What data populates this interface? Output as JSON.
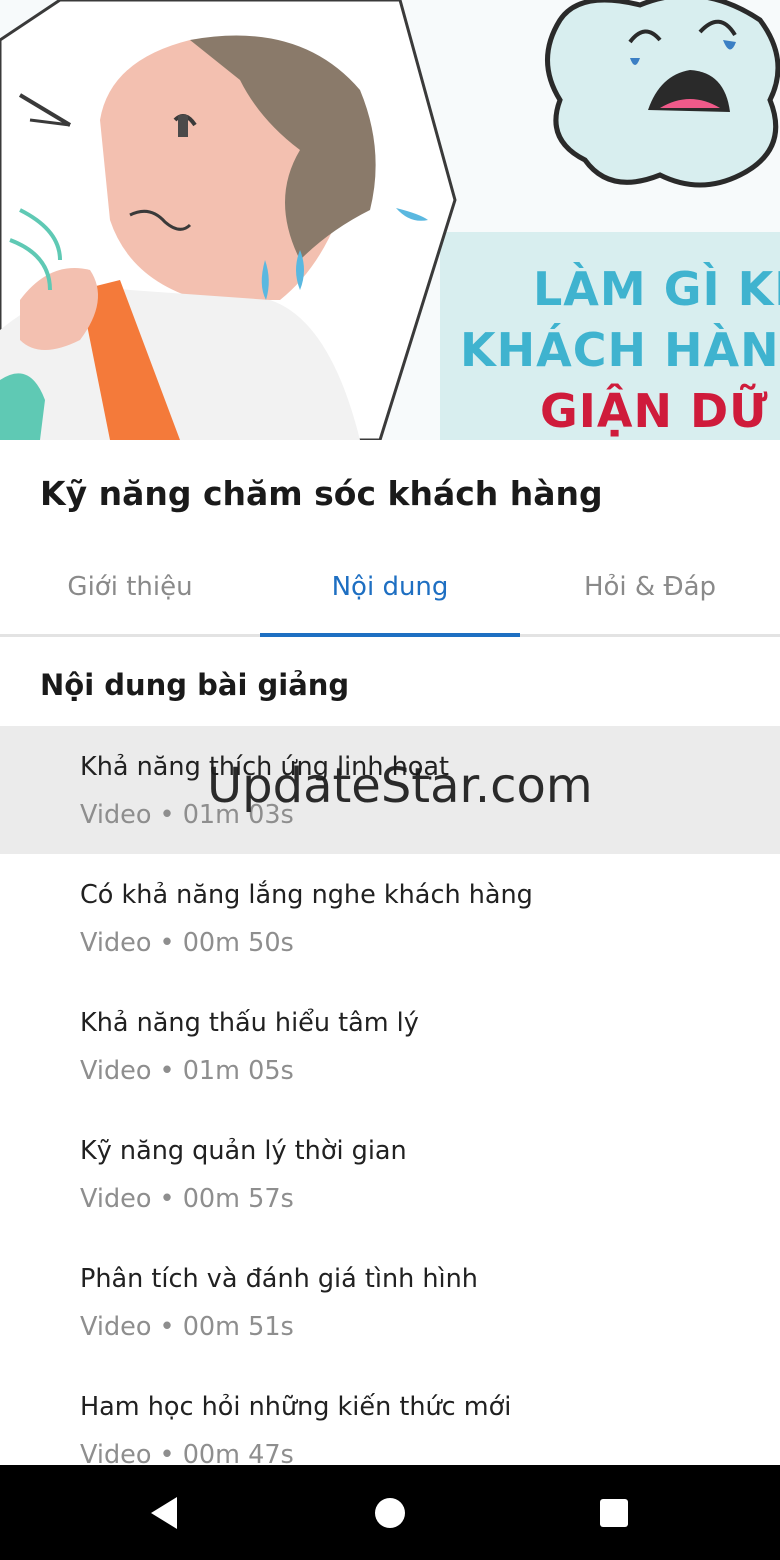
{
  "hero": {
    "image_text_lines": [
      "LÀM GÌ KHI",
      "KHÁCH HÀNG",
      "GIẬN DỮ"
    ],
    "colors": {
      "cyan": "#3fb3cf",
      "red": "#cf1b3b"
    }
  },
  "header": {
    "back_icon": "close-icon"
  },
  "course": {
    "title": "Kỹ năng chăm sóc khách hàng"
  },
  "tabs": [
    {
      "label": "Giới thiệu",
      "active": false
    },
    {
      "label": "Nội dung",
      "active": true
    },
    {
      "label": "Hỏi & Đáp",
      "active": false
    }
  ],
  "content": {
    "section_title": "Nội dung bài giảng",
    "lessons": [
      {
        "title": "Khả năng thích ứng linh hoạt",
        "meta": "Video • 01m 03s",
        "highlighted": true
      },
      {
        "title": "Có khả năng lắng nghe khách hàng",
        "meta": "Video • 00m 50s",
        "highlighted": false
      },
      {
        "title": "Khả năng thấu hiểu tâm lý",
        "meta": "Video • 01m 05s",
        "highlighted": false
      },
      {
        "title": "Kỹ năng quản lý thời gian",
        "meta": "Video • 00m 57s",
        "highlighted": false
      },
      {
        "title": "Phân tích và đánh giá tình hình",
        "meta": "Video • 00m 51s",
        "highlighted": false
      },
      {
        "title": "Ham học hỏi những kiến thức mới",
        "meta": "Video • 00m 47s",
        "highlighted": false
      }
    ]
  },
  "watermark": "UpdateStar.com",
  "navbar": {
    "icons": [
      "back-triangle-icon",
      "home-circle-icon",
      "recents-square-icon"
    ]
  },
  "accent_color": "#1e6fc2"
}
